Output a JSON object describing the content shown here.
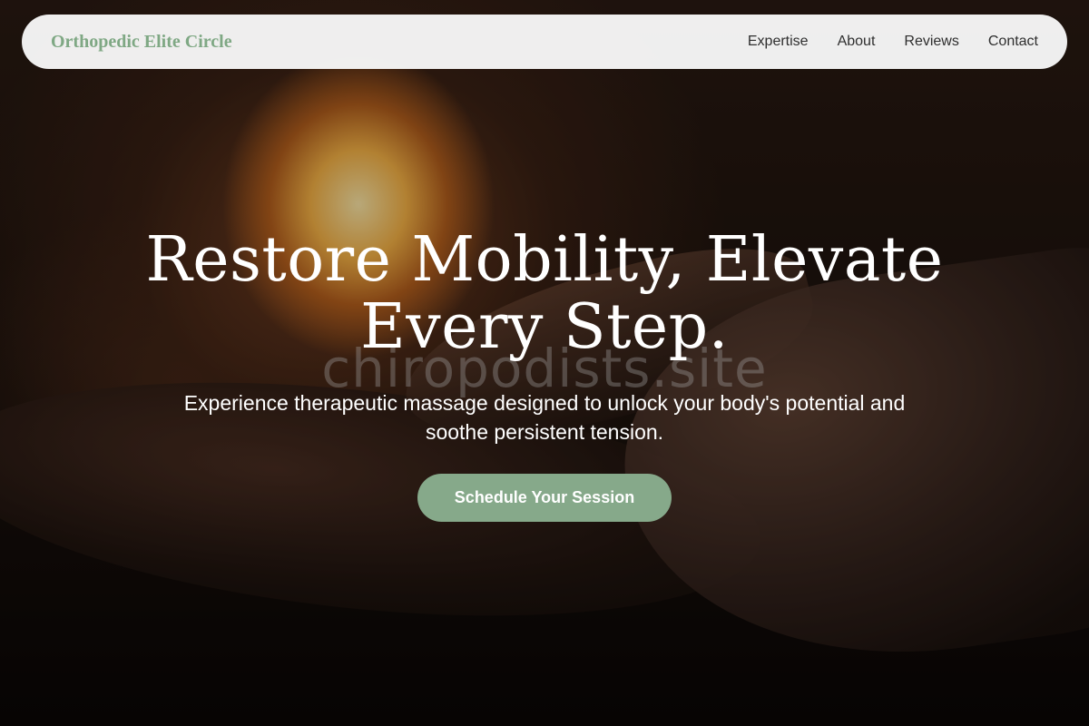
{
  "brand": {
    "name": "Orthopedic Elite Circle",
    "color": "#7fa884"
  },
  "nav": {
    "links": [
      {
        "label": "Expertise"
      },
      {
        "label": "About"
      },
      {
        "label": "Reviews"
      },
      {
        "label": "Contact"
      }
    ]
  },
  "hero": {
    "headline": "Restore Mobility, Elevate Every Step.",
    "subtitle": "Experience therapeutic massage designed to unlock your body's potential and soothe persistent tension.",
    "cta_label": "Schedule Your Session",
    "cta_color": "#86a98a",
    "watermark": "chiropodists.site"
  }
}
